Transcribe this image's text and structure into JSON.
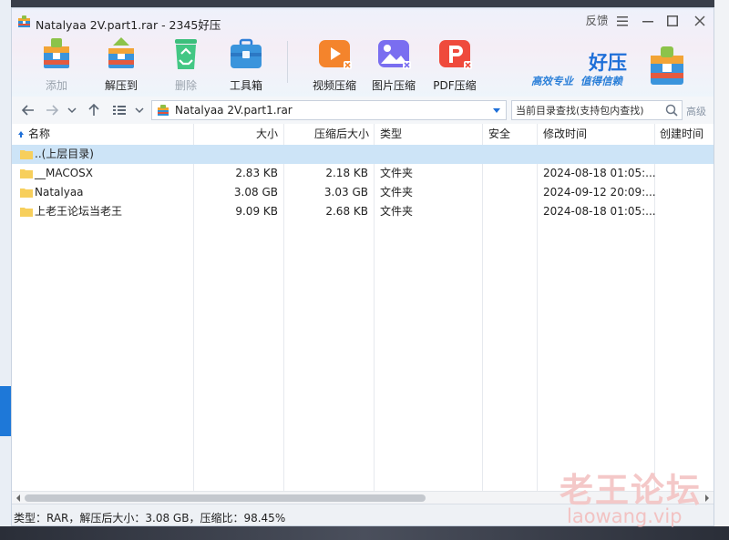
{
  "window": {
    "title": "Natalyaa 2V.part1.rar - 2345好压",
    "feedback": "反馈"
  },
  "toolbar": [
    {
      "label": "添加",
      "icon": "add-archive-icon",
      "disabled": true
    },
    {
      "label": "解压到",
      "icon": "extract-icon",
      "disabled": false
    },
    {
      "label": "删除",
      "icon": "recycle-icon",
      "disabled": true
    },
    {
      "label": "工具箱",
      "icon": "toolbox-icon",
      "disabled": false
    },
    {
      "label": "视频压缩",
      "icon": "video-compress-icon",
      "disabled": false
    },
    {
      "label": "图片压缩",
      "icon": "image-compress-icon",
      "disabled": false
    },
    {
      "label": "PDF压缩",
      "icon": "pdf-compress-icon",
      "disabled": false
    }
  ],
  "brand": {
    "name": "好压",
    "slogan": "高效专业  值得信赖"
  },
  "address": {
    "path": "Natalyaa 2V.part1.rar",
    "search_placeholder": "当前目录查找(支持包内查找)",
    "advanced": "高级"
  },
  "columns": {
    "name": "名称",
    "size": "大小",
    "packed": "压缩后大小",
    "type": "类型",
    "security": "安全",
    "modified": "修改时间",
    "created": "创建时间"
  },
  "rows": [
    {
      "name": "..(上层目录)",
      "size": "",
      "packed": "",
      "type": "",
      "modified": "",
      "selected": true
    },
    {
      "name": "__MACOSX",
      "size": "2.83 KB",
      "packed": "2.18 KB",
      "type": "文件夹",
      "modified": "2024-08-18 01:05:...",
      "selected": false
    },
    {
      "name": "Natalyaa",
      "size": "3.08 GB",
      "packed": "3.03 GB",
      "type": "文件夹",
      "modified": "2024-09-12 20:09:...",
      "selected": false
    },
    {
      "name": "上老王论坛当老王",
      "size": "9.09 KB",
      "packed": "2.68 KB",
      "type": "文件夹",
      "modified": "2024-08-18 01:05:...",
      "selected": false
    }
  ],
  "status": {
    "text": "类型：RAR，解压后大小：3.08 GB，压缩比：98.45%"
  },
  "watermark": {
    "cn": "老王论坛",
    "en": "laowang.vip"
  },
  "colors": {
    "accent": "#1e6fd8",
    "selection": "#cde4f7",
    "folder": "#f7cf5c"
  }
}
